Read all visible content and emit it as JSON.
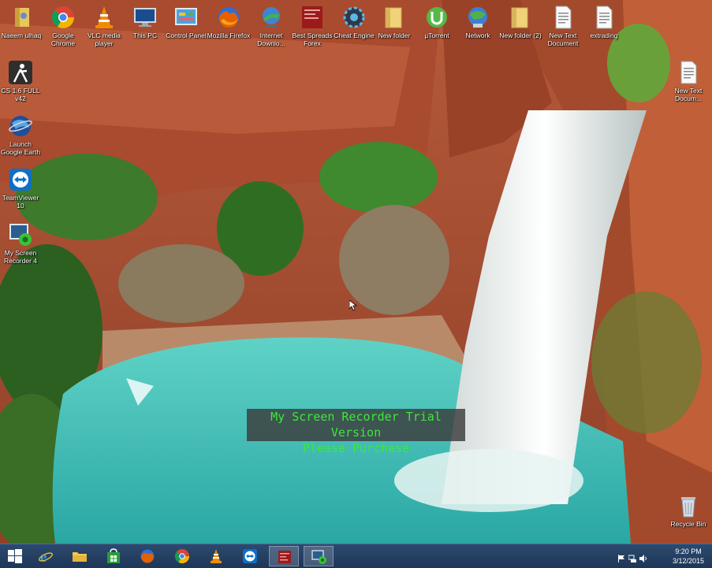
{
  "desktop": {
    "icons": [
      {
        "label": "Naeem ulhaq",
        "icon": "user-folder-icon"
      },
      {
        "label": "Google Chrome",
        "icon": "chrome-icon"
      },
      {
        "label": "VLC media player",
        "icon": "vlc-icon"
      },
      {
        "label": "This PC",
        "icon": "computer-icon"
      },
      {
        "label": "Control Panel",
        "icon": "control-panel-icon"
      },
      {
        "label": "Mozilla Firefox",
        "icon": "firefox-icon"
      },
      {
        "label": "Internet Downlo...",
        "icon": "idm-icon"
      },
      {
        "label": "Best Spreads Forex",
        "icon": "forex-icon"
      },
      {
        "label": "Cheat Engine",
        "icon": "cheat-engine-icon"
      },
      {
        "label": "New folder",
        "icon": "folder-icon"
      },
      {
        "label": "µTorrent",
        "icon": "utorrent-icon"
      },
      {
        "label": "Network",
        "icon": "network-icon"
      },
      {
        "label": "New folder (2)",
        "icon": "folder-icon"
      },
      {
        "label": "New Text Document",
        "icon": "text-document-icon"
      },
      {
        "label": "extrading",
        "icon": "text-document-icon"
      },
      {
        "label": "CS 1.6 FULL v42",
        "icon": "counter-strike-icon"
      },
      {
        "label": "Launch Google Earth",
        "icon": "google-earth-icon"
      },
      {
        "label": "TeamViewer 10",
        "icon": "teamviewer-icon"
      },
      {
        "label": "My Screen Recorder 4",
        "icon": "screen-recorder-icon"
      },
      {
        "label": "New Text Docum...",
        "icon": "text-document-icon"
      },
      {
        "label": "Recycle Bin",
        "icon": "recycle-bin-icon"
      }
    ]
  },
  "watermark": {
    "line1": "My Screen Recorder Trial Version",
    "line2": "Please Purchase"
  },
  "taskbar": {
    "buttons": [
      {
        "name": "start",
        "icon": "windows-logo-icon"
      },
      {
        "name": "internet-explorer",
        "icon": "ie-icon"
      },
      {
        "name": "file-explorer",
        "icon": "folder-icon"
      },
      {
        "name": "store",
        "icon": "store-icon"
      },
      {
        "name": "firefox",
        "icon": "firefox-icon"
      },
      {
        "name": "chrome",
        "icon": "chrome-icon"
      },
      {
        "name": "vlc",
        "icon": "vlc-icon"
      },
      {
        "name": "teamviewer",
        "icon": "teamviewer-icon"
      },
      {
        "name": "best-spreads-forex",
        "icon": "forex-icon"
      },
      {
        "name": "my-screen-recorder",
        "icon": "screen-recorder-icon"
      }
    ],
    "clock": {
      "time": "9:20 PM",
      "date": "3/12/2015"
    }
  }
}
